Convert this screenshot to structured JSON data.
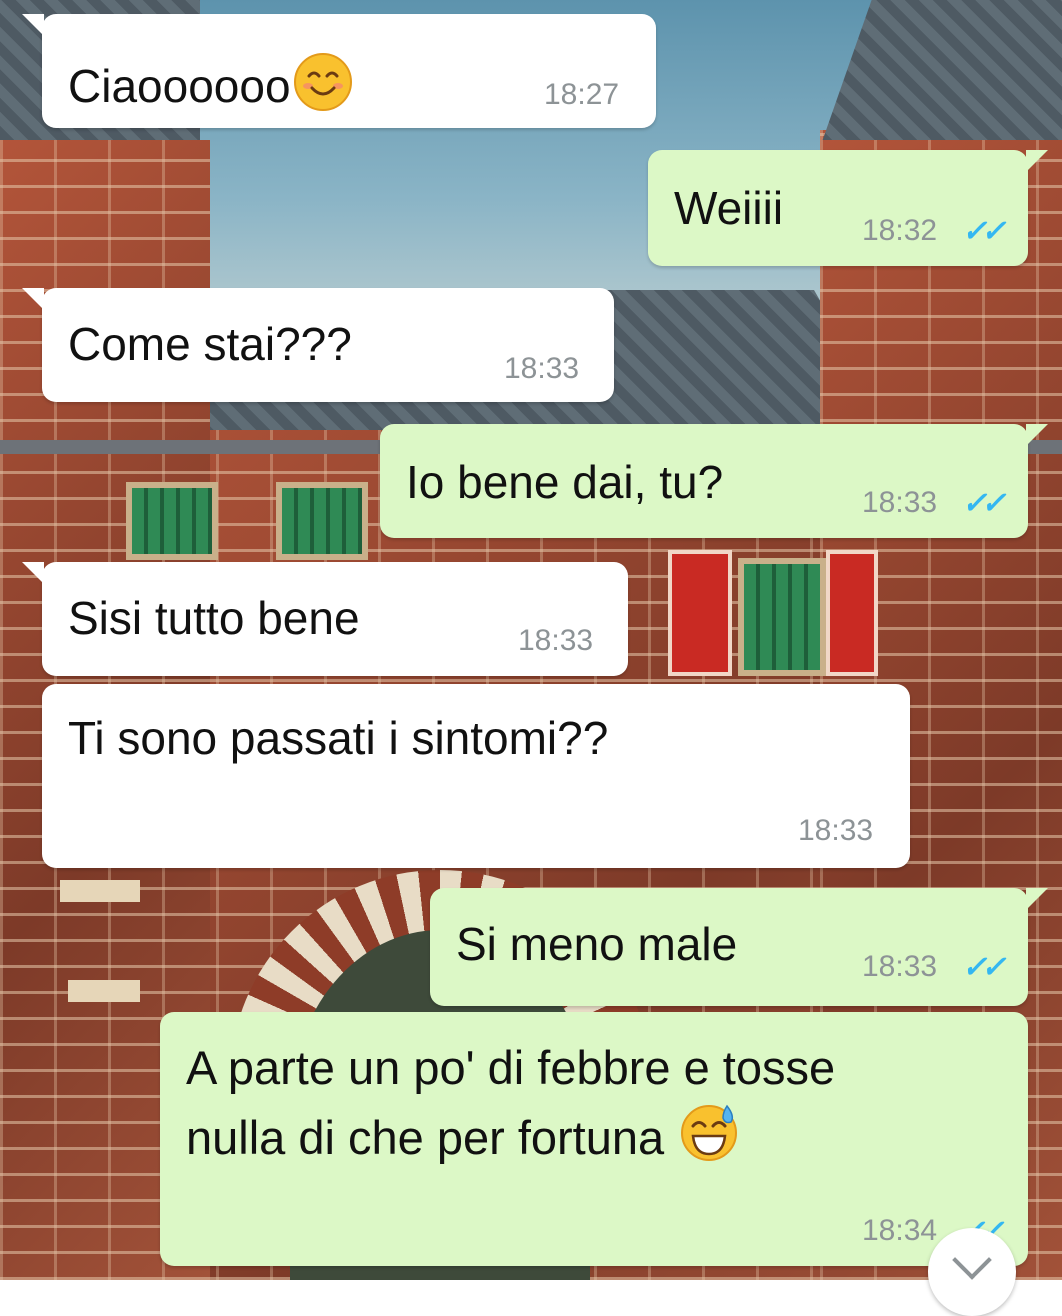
{
  "messages": [
    {
      "text": "Ciaoooooo",
      "time": "18:27",
      "direction": "incoming",
      "emoji": "smiling-face-icon"
    },
    {
      "text": "Weiiii",
      "time": "18:32",
      "direction": "outgoing",
      "read_ticks": "✓✓"
    },
    {
      "text": "Come stai???",
      "time": "18:33",
      "direction": "incoming"
    },
    {
      "text": "Io bene dai, tu?",
      "time": "18:33",
      "direction": "outgoing",
      "read_ticks": "✓✓"
    },
    {
      "text": "Sisi tutto bene",
      "time": "18:33",
      "direction": "incoming"
    },
    {
      "text": "Ti sono passati i sintomi??",
      "time": "18:33",
      "direction": "incoming"
    },
    {
      "text": "Si meno male",
      "time": "18:33",
      "direction": "outgoing",
      "read_ticks": "✓✓"
    },
    {
      "text_line1": "A parte un po' di febbre e tosse",
      "text_line2": "nulla di che per fortuna",
      "time": "18:34",
      "direction": "outgoing",
      "read_ticks": "✓✓",
      "emoji": "sweat-smile-icon"
    }
  ],
  "colors": {
    "incoming_bubble": "#ffffff",
    "outgoing_bubble": "#dcf8c6",
    "read_ticks": "#34b7f1",
    "time_text": "#8d9396"
  },
  "icons": [
    "smiling-face-icon",
    "sweat-smile-icon",
    "double-check-icon",
    "scroll-down-chevron-icon"
  ]
}
